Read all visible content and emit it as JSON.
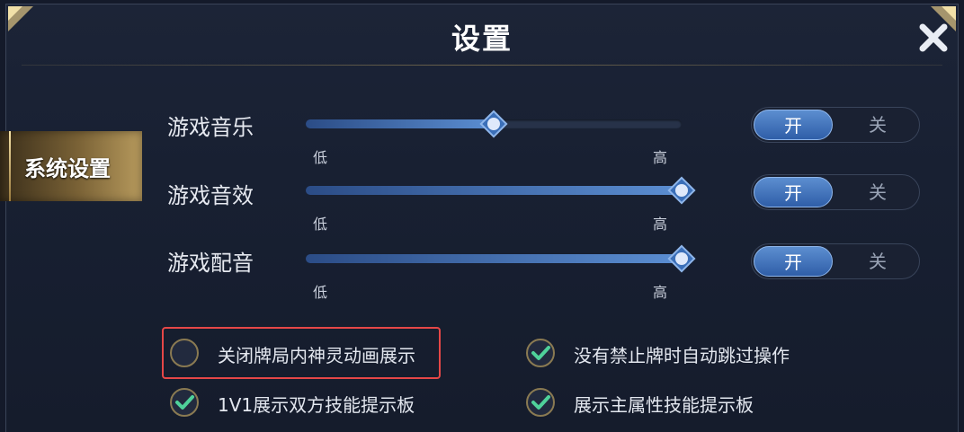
{
  "window": {
    "title": "设置",
    "close": "close-icon"
  },
  "sidebar": {
    "tab": "系统设置"
  },
  "sliders": [
    {
      "label": "游戏音乐",
      "value": 0.5,
      "low": "低",
      "high": "高",
      "toggle_on": "开",
      "toggle_off": "关",
      "state": "开"
    },
    {
      "label": "游戏音效",
      "value": 1.0,
      "low": "低",
      "high": "高",
      "toggle_on": "开",
      "toggle_off": "关",
      "state": "开"
    },
    {
      "label": "游戏配音",
      "value": 1.0,
      "low": "低",
      "high": "高",
      "toggle_on": "开",
      "toggle_off": "关",
      "state": "开"
    }
  ],
  "options": [
    {
      "label": "关闭牌局内神灵动画展示",
      "checked": false,
      "highlighted": true
    },
    {
      "label": "没有禁止牌时自动跳过操作",
      "checked": true
    },
    {
      "label": "1V1展示双方技能提示板",
      "checked": true
    },
    {
      "label": "展示主属性技能提示板",
      "checked": true
    }
  ],
  "colors": {
    "accent": "#5c8ed0",
    "check": "#4fd19a",
    "highlight": "#e54747",
    "gold": "#b79a5d"
  }
}
